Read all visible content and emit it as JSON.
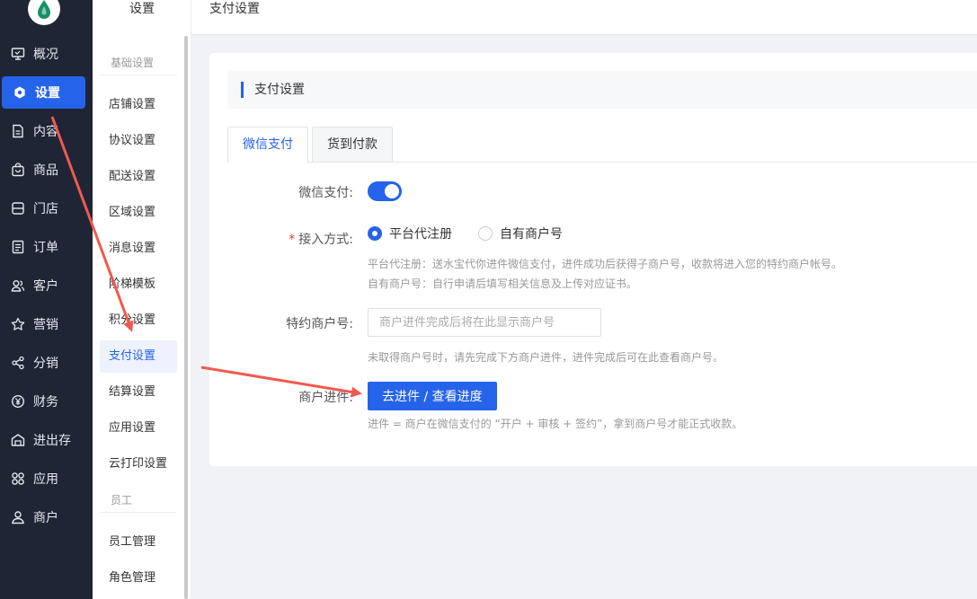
{
  "nav": {
    "items": [
      {
        "label": "概况",
        "icon": "monitor-icon"
      },
      {
        "label": "设置",
        "icon": "gear-icon"
      },
      {
        "label": "内容",
        "icon": "document-icon"
      },
      {
        "label": "商品",
        "icon": "bag-icon"
      },
      {
        "label": "门店",
        "icon": "store-icon"
      },
      {
        "label": "订单",
        "icon": "order-icon"
      },
      {
        "label": "客户",
        "icon": "users-icon"
      },
      {
        "label": "营销",
        "icon": "star-icon"
      },
      {
        "label": "分销",
        "icon": "share-icon"
      },
      {
        "label": "财务",
        "icon": "yuan-icon"
      },
      {
        "label": "进出存",
        "icon": "warehouse-icon"
      },
      {
        "label": "应用",
        "icon": "apps-icon"
      },
      {
        "label": "商户",
        "icon": "merchant-icon"
      }
    ],
    "active_index": 1
  },
  "submenu": {
    "title": "设置",
    "group_basic": "基础设置",
    "items": [
      "店铺设置",
      "协议设置",
      "配送设置",
      "区域设置",
      "消息设置",
      "阶梯模板",
      "积分设置",
      "支付设置",
      "结算设置",
      "应用设置",
      "云打印设置"
    ],
    "group_staff": "员工",
    "staff_items": [
      "员工管理",
      "角色管理"
    ],
    "active": "支付设置"
  },
  "header": {
    "title": "支付设置"
  },
  "section": {
    "title": "支付设置"
  },
  "tabs": [
    {
      "label": "微信支付",
      "active": true
    },
    {
      "label": "货到付款",
      "active": false
    }
  ],
  "form": {
    "wechat_pay_label": "微信支付:",
    "wechat_pay_enabled": true,
    "access_mode_label": "接入方式:",
    "required_mark": "*",
    "options": [
      {
        "label": "平台代注册",
        "checked": true
      },
      {
        "label": "自有商户号",
        "checked": false
      }
    ],
    "help_platform": "平台代注册：送水宝代你进件微信支付，进件成功后获得子商户号，收款将进入您的特约商户帐号。",
    "help_own": "自有商户号：自行申请后填写相关信息及上传对应证书。",
    "merchant_no_label": "特约商户号:",
    "merchant_no_placeholder": "商户进件完成后将在此显示商户号",
    "merchant_no_help": "未取得商户号时，请先完成下方商户进件，进件完成后可在此查看商户号。",
    "onboarding_label": "商户进件:",
    "onboarding_button": "去进件 / 查看进度",
    "onboarding_help": "进件 = 商户在微信支付的 “开户 + 审核 + 签约”，拿到商户号才能正式收款。"
  },
  "colors": {
    "accent": "#2563eb",
    "nav_bg": "#1f2535",
    "annotation": "#f05a4f"
  }
}
